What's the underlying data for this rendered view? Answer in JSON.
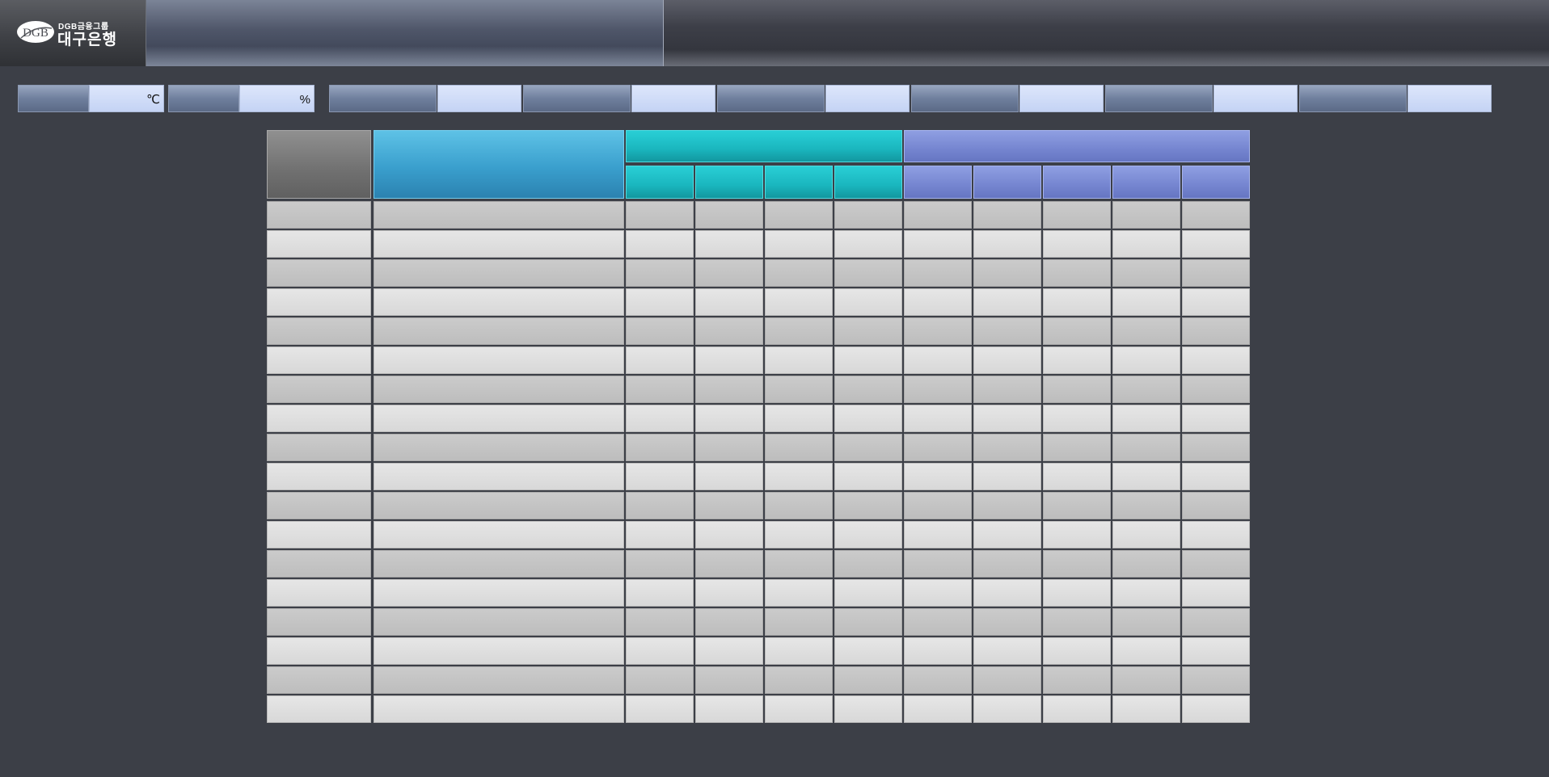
{
  "header": {
    "logo_mark": "DGB",
    "logo_group_text": "DGB금융그룹",
    "logo_name": "대구은행"
  },
  "info_bar": {
    "items": [
      {
        "label": "",
        "value": "",
        "unit": "℃"
      },
      {
        "label": "",
        "value": "",
        "unit": "%"
      },
      {
        "label": "",
        "value": "",
        "unit": ""
      },
      {
        "label": "",
        "value": "",
        "unit": ""
      },
      {
        "label": "",
        "value": "",
        "unit": ""
      },
      {
        "label": "",
        "value": "",
        "unit": ""
      },
      {
        "label": "",
        "value": "",
        "unit": ""
      },
      {
        "label": "",
        "value": "",
        "unit": ""
      }
    ]
  },
  "table": {
    "colors": {
      "col1": "#707070",
      "col2": "#3a9fcd",
      "group_a": "#1ab6be",
      "group_b": "#7585d0"
    },
    "headers": {
      "col1": "",
      "col2": "",
      "group_a": {
        "label": "",
        "subs": [
          "",
          "",
          "",
          ""
        ]
      },
      "group_b": {
        "label": "",
        "subs": [
          "",
          "",
          "",
          "",
          ""
        ]
      }
    },
    "rows": [
      {
        "cells": [
          "",
          "",
          "",
          "",
          "",
          "",
          "",
          "",
          "",
          "",
          ""
        ]
      },
      {
        "cells": [
          "",
          "",
          "",
          "",
          "",
          "",
          "",
          "",
          "",
          "",
          ""
        ]
      },
      {
        "cells": [
          "",
          "",
          "",
          "",
          "",
          "",
          "",
          "",
          "",
          "",
          ""
        ]
      },
      {
        "cells": [
          "",
          "",
          "",
          "",
          "",
          "",
          "",
          "",
          "",
          "",
          ""
        ]
      },
      {
        "cells": [
          "",
          "",
          "",
          "",
          "",
          "",
          "",
          "",
          "",
          "",
          ""
        ]
      },
      {
        "cells": [
          "",
          "",
          "",
          "",
          "",
          "",
          "",
          "",
          "",
          "",
          ""
        ]
      },
      {
        "cells": [
          "",
          "",
          "",
          "",
          "",
          "",
          "",
          "",
          "",
          "",
          ""
        ]
      },
      {
        "cells": [
          "",
          "",
          "",
          "",
          "",
          "",
          "",
          "",
          "",
          "",
          ""
        ]
      },
      {
        "cells": [
          "",
          "",
          "",
          "",
          "",
          "",
          "",
          "",
          "",
          "",
          ""
        ]
      },
      {
        "cells": [
          "",
          "",
          "",
          "",
          "",
          "",
          "",
          "",
          "",
          "",
          ""
        ]
      },
      {
        "cells": [
          "",
          "",
          "",
          "",
          "",
          "",
          "",
          "",
          "",
          "",
          ""
        ]
      },
      {
        "cells": [
          "",
          "",
          "",
          "",
          "",
          "",
          "",
          "",
          "",
          "",
          ""
        ]
      },
      {
        "cells": [
          "",
          "",
          "",
          "",
          "",
          "",
          "",
          "",
          "",
          "",
          ""
        ]
      },
      {
        "cells": [
          "",
          "",
          "",
          "",
          "",
          "",
          "",
          "",
          "",
          "",
          ""
        ]
      },
      {
        "cells": [
          "",
          "",
          "",
          "",
          "",
          "",
          "",
          "",
          "",
          "",
          ""
        ]
      },
      {
        "cells": [
          "",
          "",
          "",
          "",
          "",
          "",
          "",
          "",
          "",
          "",
          ""
        ]
      },
      {
        "cells": [
          "",
          "",
          "",
          "",
          "",
          "",
          "",
          "",
          "",
          "",
          ""
        ]
      },
      {
        "cells": [
          "",
          "",
          "",
          "",
          "",
          "",
          "",
          "",
          "",
          "",
          ""
        ]
      }
    ]
  }
}
